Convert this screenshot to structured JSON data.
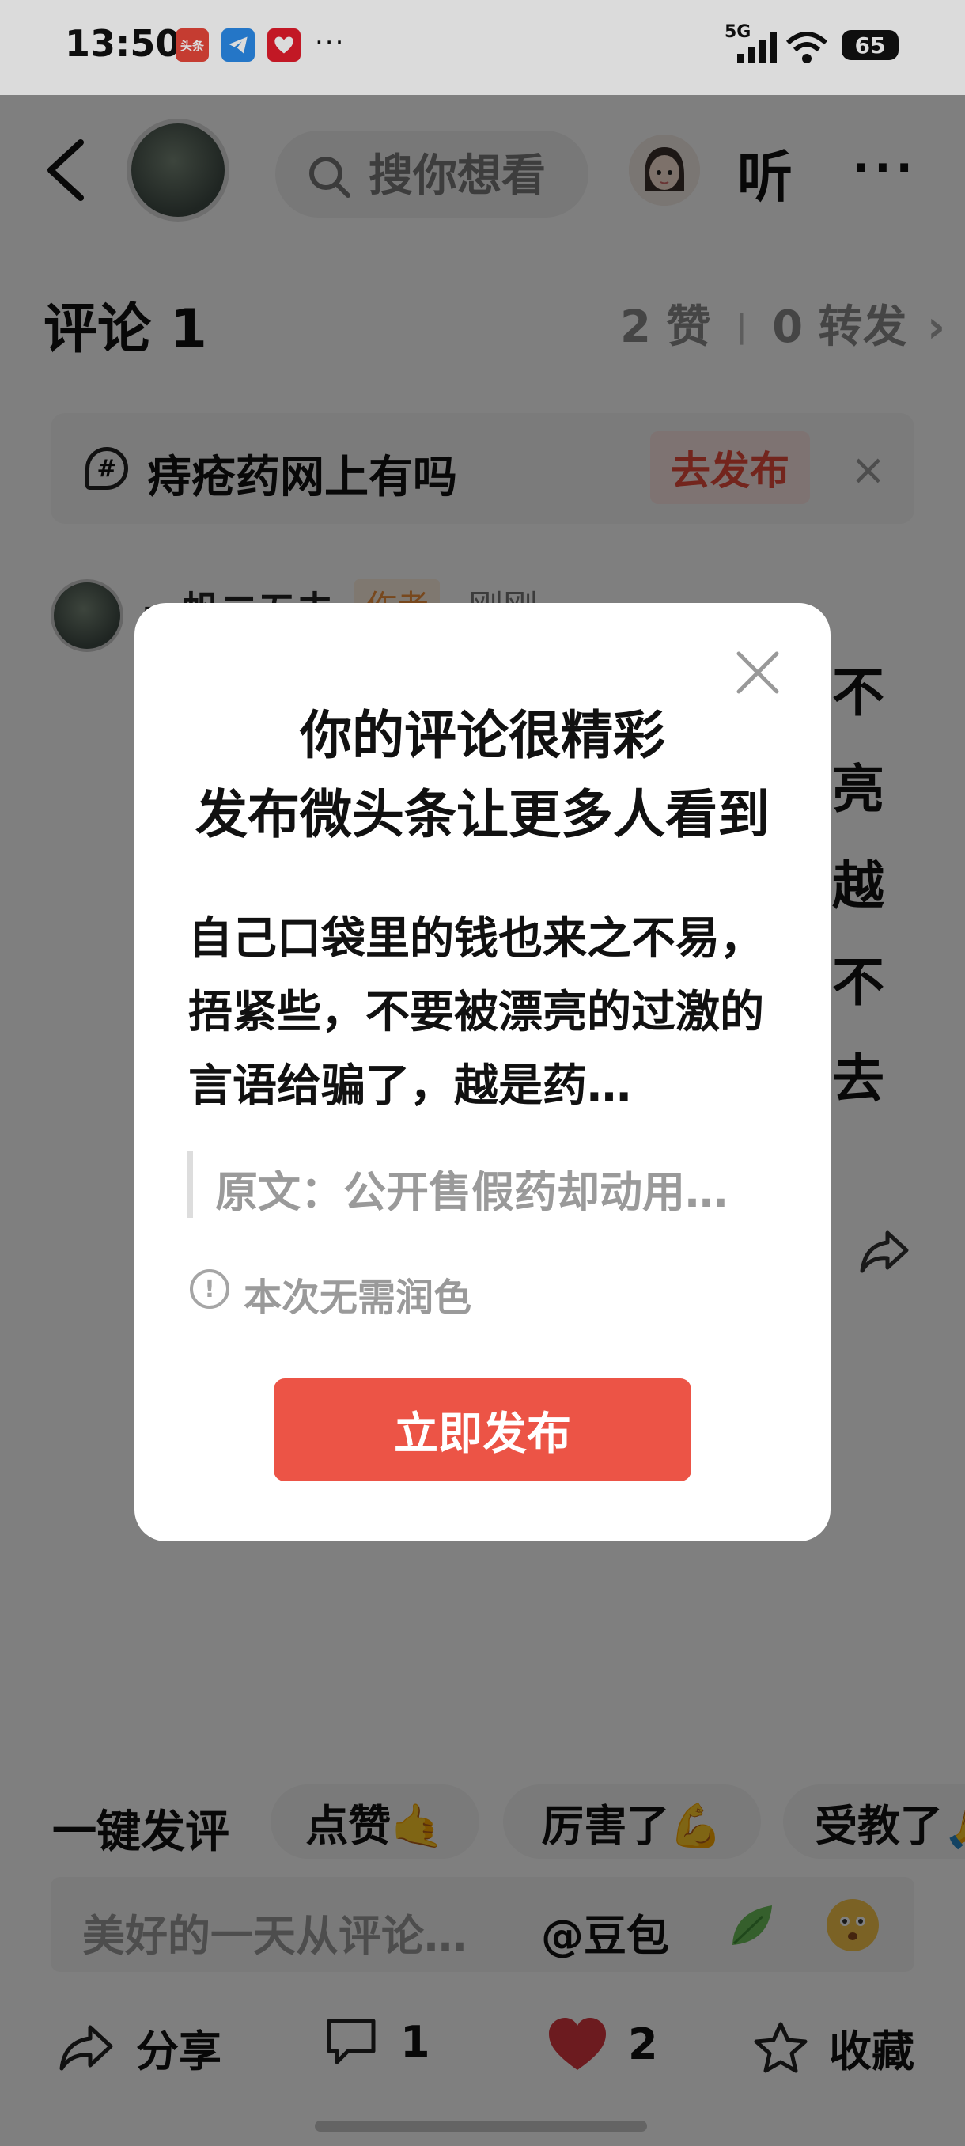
{
  "status_bar": {
    "time": "13:50",
    "app_icons": [
      "头条",
      "",
      ""
    ],
    "more_indicator": "···",
    "network": "5G",
    "battery": "65"
  },
  "header": {
    "search_placeholder": "搜你想看",
    "listen_label": "听",
    "more_label": "···"
  },
  "comments": {
    "title": "评论 1",
    "likes": "2 赞",
    "separator": "|",
    "reposts": "0 转发",
    "chevron": "›"
  },
  "topic": {
    "text": "痔疮药网上有吗",
    "publish_label": "去发布",
    "close_label": "×"
  },
  "comment_item": {
    "author": "一帆二五去",
    "tag": "作者",
    "time": "刚刚",
    "peek_chars": [
      "不",
      "亮",
      "越",
      "不",
      "去"
    ]
  },
  "modal": {
    "title_line1": "你的评论很精彩",
    "title_line2": "发布微头条让更多人看到",
    "body": "自己口袋里的钱也来之不易，捂紧些，不要被漂亮的过激的言语给骗了，越是药…",
    "quote": "原文：公开售假药却动用…",
    "info_icon": "!",
    "info": "本次无需润色",
    "publish_label": "立即发布"
  },
  "quick_replies": {
    "label": "一键发评",
    "chips": [
      "点赞🤙",
      "厉害了💪",
      "受教了🙏"
    ]
  },
  "input": {
    "placeholder": "美好的一天从评论…",
    "mention": "@豆包"
  },
  "bottom_bar": {
    "share_label": "分享",
    "comment_count": "1",
    "like_count": "2",
    "favorite_label": "收藏"
  },
  "colors": {
    "accent_red": "#ec5446",
    "like_red": "#d9363e",
    "overlay": "rgba(0,0,0,0.5)"
  }
}
